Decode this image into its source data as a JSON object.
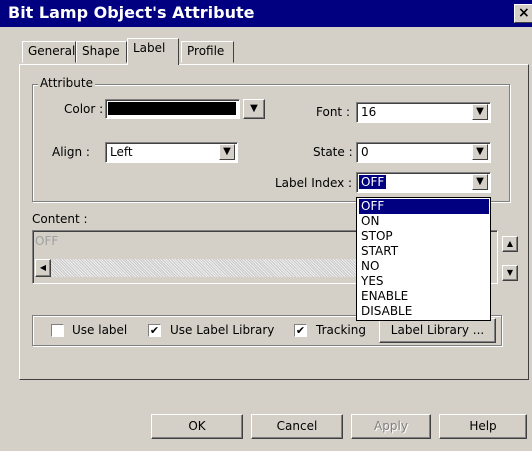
{
  "window": {
    "title": "Bit Lamp Object's Attribute",
    "close_glyph": "×"
  },
  "tabs": [
    {
      "label": "General"
    },
    {
      "label": "Shape"
    },
    {
      "label": "Label"
    },
    {
      "label": "Profile"
    }
  ],
  "attribute_group": {
    "title": "Attribute",
    "color_label": "Color :",
    "color_value": "#000000",
    "align_label": "Align :",
    "align_value": "Left",
    "font_label": "Font :",
    "font_value": "16",
    "state_label": "State :",
    "state_value": "0",
    "label_index_label": "Label Index :",
    "label_index_value": "OFF"
  },
  "label_index_options": [
    "OFF",
    "ON",
    "STOP",
    "START",
    "NO",
    "YES",
    "ENABLE",
    "DISABLE"
  ],
  "content": {
    "label": "Content :",
    "text": "OFF"
  },
  "options": {
    "use_label": {
      "label": "Use label",
      "checked": false
    },
    "use_label_library": {
      "label": "Use Label Library",
      "checked": true
    },
    "tracking": {
      "label": "Tracking",
      "checked": true
    },
    "label_library_button": "Label Library ..."
  },
  "footer": {
    "ok": "OK",
    "cancel": "Cancel",
    "apply": "Apply",
    "help": "Help"
  }
}
